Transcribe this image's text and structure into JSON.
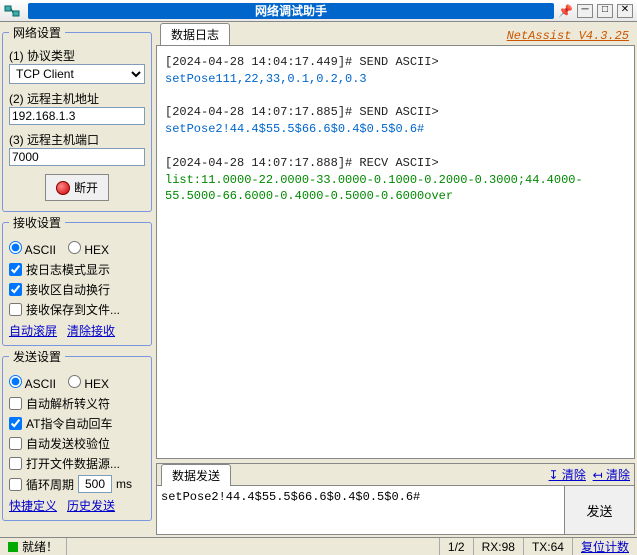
{
  "window": {
    "title": "网络调试助手",
    "version_link": "NetAssist V4.3.25"
  },
  "network": {
    "legend": "网络设置",
    "proto_label": "(1) 协议类型",
    "proto_value": "TCP Client",
    "host_label": "(2) 远程主机地址",
    "host_value": "192.168.1.3",
    "port_label": "(3) 远程主机端口",
    "port_value": "7000",
    "disconnect": "断开"
  },
  "recv": {
    "legend": "接收设置",
    "ascii": "ASCII",
    "hex": "HEX",
    "opt1": "按日志模式显示",
    "opt2": "接收区自动换行",
    "opt3": "接收保存到文件...",
    "link1": "自动滚屏",
    "link2": "清除接收"
  },
  "send": {
    "legend": "发送设置",
    "ascii": "ASCII",
    "hex": "HEX",
    "opt1": "自动解析转义符",
    "opt2": "AT指令自动回车",
    "opt3": "自动发送校验位",
    "opt4": "打开文件数据源...",
    "opt5_a": "循环周期",
    "opt5_val": "500",
    "opt5_b": "ms",
    "link1": "快捷定义",
    "link2": "历史发送"
  },
  "log": {
    "tab": "数据日志",
    "entries": [
      {
        "ts": "[2024-04-28 14:04:17.449]# SEND ASCII>",
        "body": "setPose111,22,33,0.1,0.2,0.3",
        "kind": "send"
      },
      {
        "ts": "[2024-04-28 14:07:17.885]# SEND ASCII>",
        "body": "setPose2!44.4$55.5$66.6$0.4$0.5$0.6#",
        "kind": "send"
      },
      {
        "ts": "[2024-04-28 14:07:17.888]# RECV ASCII>",
        "body": "list:11.0000-22.0000-33.0000-0.1000-0.2000-0.3000;44.4000-55.5000-66.6000-0.4000-0.5000-0.6000over",
        "kind": "recv"
      }
    ]
  },
  "sendpanel": {
    "tab": "数据发送",
    "clear_log": "清除",
    "clear_log_icon_title": "↓",
    "clear_send": "清除",
    "content": "setPose2!44.4$55.5$66.6$0.4$0.5$0.6#",
    "button": "发送"
  },
  "status": {
    "ready": "就绪！",
    "page": "1/2",
    "rx": "RX:98",
    "tx": "TX:64",
    "reset": "复位计数"
  }
}
